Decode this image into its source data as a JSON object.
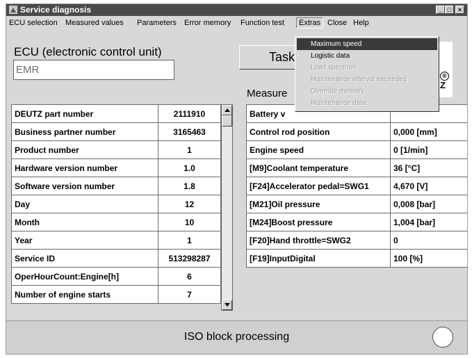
{
  "window": {
    "title": "Service diagnosis",
    "controls": [
      "_",
      "□",
      "×"
    ]
  },
  "menubar": {
    "items": [
      "ECU selection",
      "Measured values",
      "Parameters",
      "Error memory",
      "Function test",
      "Extras",
      "Close",
      "Help"
    ],
    "active": "Extras"
  },
  "extras_menu": {
    "items": [
      {
        "label": "Maximum speed",
        "state": "highlighted"
      },
      {
        "label": "Logistic data",
        "state": "enabled"
      },
      {
        "label": "Load spectrum",
        "state": "disabled"
      },
      {
        "label": "Maintenance interval exceeded",
        "state": "disabled"
      },
      {
        "label": "Override memory",
        "state": "disabled"
      },
      {
        "label": "Maintenance data",
        "state": "disabled"
      }
    ]
  },
  "ecu": {
    "label": "ECU (electronic control unit)",
    "value": "EMR"
  },
  "task_button": {
    "label": "Task"
  },
  "logo": {
    "registered": "®",
    "letter": "Z"
  },
  "measured": {
    "label": "Measure"
  },
  "ecu_info_table": [
    {
      "name": "DEUTZ part number",
      "value": "2111910"
    },
    {
      "name": "Business partner number",
      "value": "3165463"
    },
    {
      "name": "Product number",
      "value": "1"
    },
    {
      "name": "Hardware version number",
      "value": "1.0"
    },
    {
      "name": "Software version number",
      "value": "1.8"
    },
    {
      "name": "Day",
      "value": "12"
    },
    {
      "name": "Month",
      "value": "10"
    },
    {
      "name": "Year",
      "value": "1"
    },
    {
      "name": "Service ID",
      "value": "513298287"
    },
    {
      "name": "OperHourCount:Engine[h]",
      "value": "6"
    },
    {
      "name": "Number of engine starts",
      "value": "7"
    }
  ],
  "measured_table": [
    {
      "name": "Battery v",
      "value": ""
    },
    {
      "name": "Control rod position",
      "value": "0,000 [mm]"
    },
    {
      "name": "Engine speed",
      "value": "0 [1/min]"
    },
    {
      "name": "[M9]Coolant temperature",
      "value": "36 [°C]"
    },
    {
      "name": "[F24]Accelerator pedal=SWG1",
      "value": "4,670 [V]"
    },
    {
      "name": "[M21]Oil pressure",
      "value": "0,008 [bar]"
    },
    {
      "name": "[M24]Boost pressure",
      "value": "1,004 [bar]"
    },
    {
      "name": "[F20]Hand throttle=SWG2",
      "value": "0"
    },
    {
      "name": "[F19]InputDigital",
      "value": "100 [%]"
    }
  ],
  "status": {
    "text": "ISO block processing"
  },
  "colors": {
    "title_bar": "#4a4a4a",
    "window_bg": "#d8d8d8",
    "menu_highlight": "#3a3a3a"
  }
}
